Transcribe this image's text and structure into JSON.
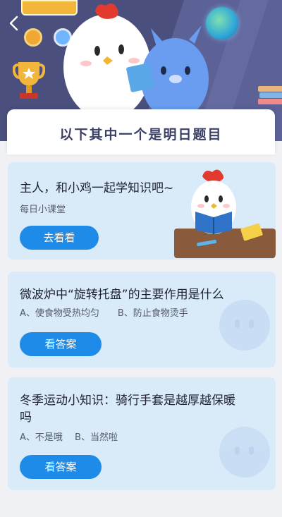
{
  "header": {
    "back_icon": "chevron-left-icon",
    "title": "以下其中一个是明日题目"
  },
  "cards": [
    {
      "title": "主人，和小鸡一起学知识吧~",
      "subtitle": "每日小课堂",
      "button_label": "去看看"
    },
    {
      "title": "微波炉中“旋转托盘”的主要作用是什么",
      "options": "A、使食物受热均匀　　B、防止食物烫手",
      "button_label": "看答案"
    },
    {
      "title_line1": "冬季运动小知识：骑行手套是越厚越保暖",
      "title_line2": "吗",
      "options": "A、不是哦　 B、当然啦",
      "button_label": "看答案"
    }
  ],
  "colors": {
    "hero_bg": "#4a4f7d",
    "card_bg": "#d9eaf9",
    "button_bg": "#1e8be8",
    "title_text": "#3a3f66"
  }
}
